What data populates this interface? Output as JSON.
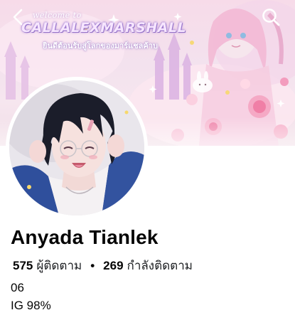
{
  "cover": {
    "welcome_text": "welcome to",
    "title_text": "CALLALEXMARSHALL",
    "subtitle_text": "ยินดีต้อนรับสู่โลกของมาร์แชลค้าบ"
  },
  "nav": {
    "back_icon": "chevron-left-icon",
    "search_icon": "search-icon"
  },
  "profile": {
    "name": "Anyada Tianlek",
    "followers_count": "575",
    "followers_label": "ผู้ติดตาม",
    "separator": "•",
    "following_count": "269",
    "following_label": "กำลังติดตาม",
    "bio": [
      "06",
      "IG 98%"
    ]
  },
  "colors": {
    "text_primary": "#050505",
    "cover_pink": "#f7dbe9",
    "cover_purple": "#b48de0"
  }
}
